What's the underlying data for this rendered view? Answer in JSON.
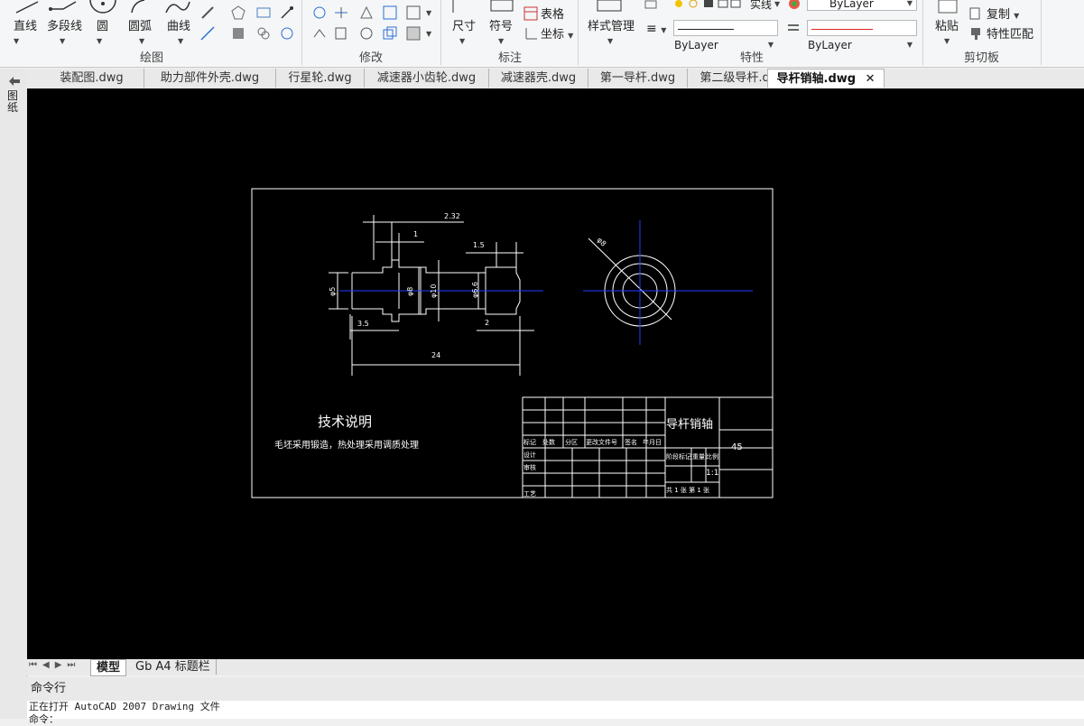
{
  "ribbon": {
    "draw": {
      "label": "绘图",
      "line": "直线",
      "polyline": "多段线",
      "circle": "圆",
      "arc": "圆弧",
      "curve": "曲线"
    },
    "modify": {
      "label": "修改"
    },
    "annotate": {
      "label": "标注",
      "dimension": "尺寸",
      "symbol": "符号",
      "table": "表格",
      "coordinate": "坐标"
    },
    "properties": {
      "label": "特性",
      "style_manager": "样式管理",
      "linetype": "ByLayer",
      "color": "ByLayer",
      "layer": "ByLayer",
      "font_partial": "实线"
    },
    "clipboard": {
      "label": "剪切板",
      "paste": "粘贴",
      "copy": "复制",
      "match": "特性匹配"
    }
  },
  "tabs": [
    "装配图.dwg",
    "助力部件外壳.dwg",
    "行星轮.dwg",
    "减速器小齿轮.dwg",
    "减速器壳.dwg",
    "第一导杆.dwg",
    "第二级导杆.dwg",
    "导杆销轴.dwg"
  ],
  "active_tab_index": 7,
  "left_strip": {
    "label": "图纸"
  },
  "layout_tabs": [
    "模型",
    "Gb A4 标题栏"
  ],
  "command": {
    "header": "命令行",
    "log": [
      "正在打开 AutoCAD 2007 Drawing 文件",
      "命令："
    ]
  },
  "drawing": {
    "dims": {
      "d232": "2.32",
      "d1": "1",
      "d15": "1.5",
      "phi5": "φ5",
      "phi8": "φ8",
      "phi10": "φ10",
      "phi66": "φ6.6",
      "d35": "3.5",
      "d2": "2",
      "d24": "24",
      "phi8b": "φ8"
    },
    "tech_title": "技术说明",
    "tech_note": "毛坯采用锻造，热处理采用调质处理",
    "title_block": {
      "part_name": "导杆销轴",
      "material": "45",
      "scale": "1:1",
      "sheet": "共 1 张 第 1 张",
      "labels": [
        "标记",
        "处数",
        "分区",
        "更改文件号",
        "签名",
        "年月日",
        "设计",
        "审核",
        "工艺",
        "阶段标记",
        "重量",
        "比例"
      ]
    }
  },
  "colors": {
    "canvas": "#000000",
    "line": "#ffffff",
    "center": "#1f3cff"
  }
}
